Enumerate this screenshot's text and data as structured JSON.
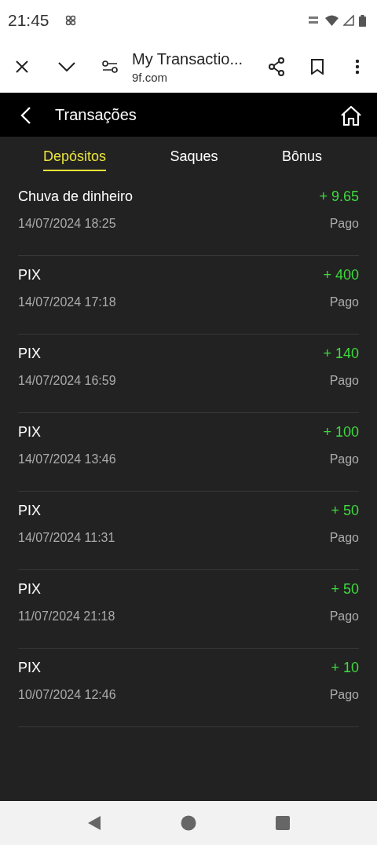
{
  "status_bar": {
    "time": "21:45"
  },
  "browser": {
    "title": "My Transactio...",
    "url": "9f.com"
  },
  "header": {
    "title": "Transações"
  },
  "tabs": [
    {
      "label": "Depósitos",
      "selected": true
    },
    {
      "label": "Saques",
      "selected": false
    },
    {
      "label": "Bônus",
      "selected": false
    }
  ],
  "transactions": [
    {
      "name": "Chuva de dinheiro",
      "amount": "+ 9.65",
      "date": "14/07/2024 18:25",
      "status": "Pago"
    },
    {
      "name": "PIX",
      "amount": "+ 400",
      "date": "14/07/2024 17:18",
      "status": "Pago"
    },
    {
      "name": "PIX",
      "amount": "+ 140",
      "date": "14/07/2024 16:59",
      "status": "Pago"
    },
    {
      "name": "PIX",
      "amount": "+ 100",
      "date": "14/07/2024 13:46",
      "status": "Pago"
    },
    {
      "name": "PIX",
      "amount": "+ 50",
      "date": "14/07/2024 11:31",
      "status": "Pago"
    },
    {
      "name": "PIX",
      "amount": "+ 50",
      "date": "11/07/2024 21:18",
      "status": "Pago"
    },
    {
      "name": "PIX",
      "amount": "+ 10",
      "date": "10/07/2024 12:46",
      "status": "Pago"
    }
  ]
}
